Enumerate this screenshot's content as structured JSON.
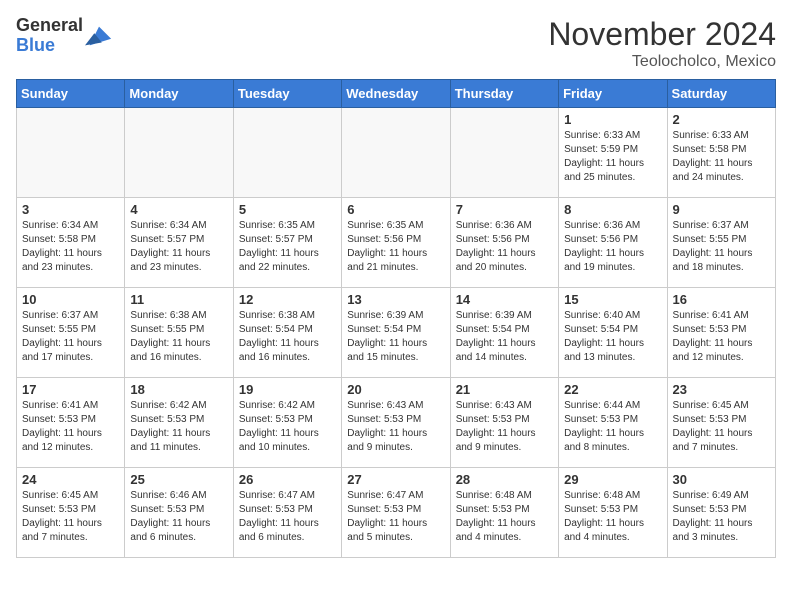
{
  "logo": {
    "general": "General",
    "blue": "Blue"
  },
  "header": {
    "month": "November 2024",
    "location": "Teolocholco, Mexico"
  },
  "weekdays": [
    "Sunday",
    "Monday",
    "Tuesday",
    "Wednesday",
    "Thursday",
    "Friday",
    "Saturday"
  ],
  "weeks": [
    [
      {
        "day": "",
        "info": ""
      },
      {
        "day": "",
        "info": ""
      },
      {
        "day": "",
        "info": ""
      },
      {
        "day": "",
        "info": ""
      },
      {
        "day": "",
        "info": ""
      },
      {
        "day": "1",
        "info": "Sunrise: 6:33 AM\nSunset: 5:59 PM\nDaylight: 11 hours and 25 minutes."
      },
      {
        "day": "2",
        "info": "Sunrise: 6:33 AM\nSunset: 5:58 PM\nDaylight: 11 hours and 24 minutes."
      }
    ],
    [
      {
        "day": "3",
        "info": "Sunrise: 6:34 AM\nSunset: 5:58 PM\nDaylight: 11 hours and 23 minutes."
      },
      {
        "day": "4",
        "info": "Sunrise: 6:34 AM\nSunset: 5:57 PM\nDaylight: 11 hours and 23 minutes."
      },
      {
        "day": "5",
        "info": "Sunrise: 6:35 AM\nSunset: 5:57 PM\nDaylight: 11 hours and 22 minutes."
      },
      {
        "day": "6",
        "info": "Sunrise: 6:35 AM\nSunset: 5:56 PM\nDaylight: 11 hours and 21 minutes."
      },
      {
        "day": "7",
        "info": "Sunrise: 6:36 AM\nSunset: 5:56 PM\nDaylight: 11 hours and 20 minutes."
      },
      {
        "day": "8",
        "info": "Sunrise: 6:36 AM\nSunset: 5:56 PM\nDaylight: 11 hours and 19 minutes."
      },
      {
        "day": "9",
        "info": "Sunrise: 6:37 AM\nSunset: 5:55 PM\nDaylight: 11 hours and 18 minutes."
      }
    ],
    [
      {
        "day": "10",
        "info": "Sunrise: 6:37 AM\nSunset: 5:55 PM\nDaylight: 11 hours and 17 minutes."
      },
      {
        "day": "11",
        "info": "Sunrise: 6:38 AM\nSunset: 5:55 PM\nDaylight: 11 hours and 16 minutes."
      },
      {
        "day": "12",
        "info": "Sunrise: 6:38 AM\nSunset: 5:54 PM\nDaylight: 11 hours and 16 minutes."
      },
      {
        "day": "13",
        "info": "Sunrise: 6:39 AM\nSunset: 5:54 PM\nDaylight: 11 hours and 15 minutes."
      },
      {
        "day": "14",
        "info": "Sunrise: 6:39 AM\nSunset: 5:54 PM\nDaylight: 11 hours and 14 minutes."
      },
      {
        "day": "15",
        "info": "Sunrise: 6:40 AM\nSunset: 5:54 PM\nDaylight: 11 hours and 13 minutes."
      },
      {
        "day": "16",
        "info": "Sunrise: 6:41 AM\nSunset: 5:53 PM\nDaylight: 11 hours and 12 minutes."
      }
    ],
    [
      {
        "day": "17",
        "info": "Sunrise: 6:41 AM\nSunset: 5:53 PM\nDaylight: 11 hours and 12 minutes."
      },
      {
        "day": "18",
        "info": "Sunrise: 6:42 AM\nSunset: 5:53 PM\nDaylight: 11 hours and 11 minutes."
      },
      {
        "day": "19",
        "info": "Sunrise: 6:42 AM\nSunset: 5:53 PM\nDaylight: 11 hours and 10 minutes."
      },
      {
        "day": "20",
        "info": "Sunrise: 6:43 AM\nSunset: 5:53 PM\nDaylight: 11 hours and 9 minutes."
      },
      {
        "day": "21",
        "info": "Sunrise: 6:43 AM\nSunset: 5:53 PM\nDaylight: 11 hours and 9 minutes."
      },
      {
        "day": "22",
        "info": "Sunrise: 6:44 AM\nSunset: 5:53 PM\nDaylight: 11 hours and 8 minutes."
      },
      {
        "day": "23",
        "info": "Sunrise: 6:45 AM\nSunset: 5:53 PM\nDaylight: 11 hours and 7 minutes."
      }
    ],
    [
      {
        "day": "24",
        "info": "Sunrise: 6:45 AM\nSunset: 5:53 PM\nDaylight: 11 hours and 7 minutes."
      },
      {
        "day": "25",
        "info": "Sunrise: 6:46 AM\nSunset: 5:53 PM\nDaylight: 11 hours and 6 minutes."
      },
      {
        "day": "26",
        "info": "Sunrise: 6:47 AM\nSunset: 5:53 PM\nDaylight: 11 hours and 6 minutes."
      },
      {
        "day": "27",
        "info": "Sunrise: 6:47 AM\nSunset: 5:53 PM\nDaylight: 11 hours and 5 minutes."
      },
      {
        "day": "28",
        "info": "Sunrise: 6:48 AM\nSunset: 5:53 PM\nDaylight: 11 hours and 4 minutes."
      },
      {
        "day": "29",
        "info": "Sunrise: 6:48 AM\nSunset: 5:53 PM\nDaylight: 11 hours and 4 minutes."
      },
      {
        "day": "30",
        "info": "Sunrise: 6:49 AM\nSunset: 5:53 PM\nDaylight: 11 hours and 3 minutes."
      }
    ]
  ]
}
